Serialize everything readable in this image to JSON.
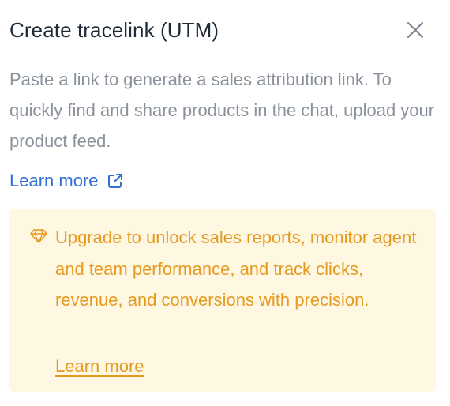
{
  "header": {
    "title": "Create tracelink (UTM)"
  },
  "description": "Paste a link to generate a sales attribution link. To quickly find and share products in the chat, upload your product feed.",
  "learn_more": {
    "label": "Learn more"
  },
  "upgrade": {
    "message": "Upgrade to unlock sales reports, monitor agent and team performance, and track clicks, revenue, and conversions with precision.",
    "link_label": "Learn more"
  },
  "icons": {
    "close": "close-icon",
    "external": "external-link-icon",
    "gem": "diamond-icon"
  },
  "colors": {
    "title": "#1f2a37",
    "description": "#8a929c",
    "link": "#2f6fd6",
    "upgrade_bg": "#fef7e1",
    "upgrade_text": "#e69a1f"
  }
}
